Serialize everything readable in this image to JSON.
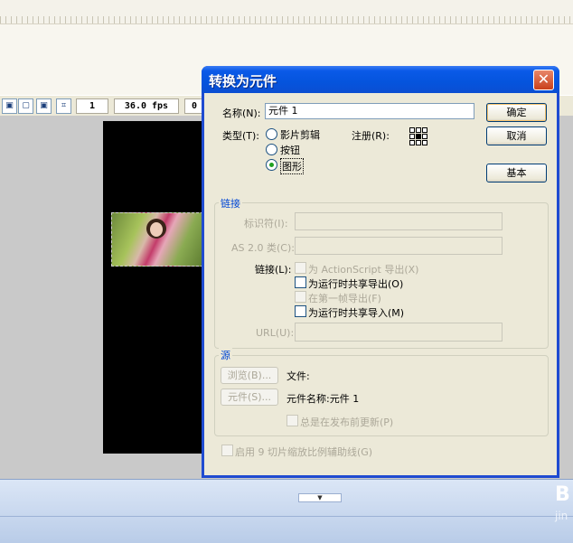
{
  "timeline": {
    "frame": "1",
    "fps": "36.0 fps",
    "time": "0"
  },
  "dialog": {
    "title": "转换为元件",
    "close": "✕",
    "name_label": "名称(N):",
    "name_value": "元件 1",
    "ok_label": "确定",
    "cancel_label": "取消",
    "basic_label": "基本",
    "type_label": "类型(T):",
    "types": [
      {
        "label": "影片剪辑",
        "selected": false
      },
      {
        "label": "按钮",
        "selected": false
      },
      {
        "label": "图形",
        "selected": true
      }
    ],
    "registration_label": "注册(R):"
  },
  "linkage": {
    "group_title": "链接",
    "identifier_label": "标识符(I):",
    "as_class_label": "AS 2.0 类(C):",
    "linkage_label": "链接(L):",
    "options": [
      {
        "label": "为 ActionScript 导出(X)",
        "enabled": false
      },
      {
        "label": "为运行时共享导出(O)",
        "enabled": true
      },
      {
        "label": "在第一帧导出(F)",
        "enabled": false
      },
      {
        "label": "为运行时共享导入(M)",
        "enabled": true
      }
    ],
    "url_label": "URL(U):"
  },
  "source": {
    "group_title": "源",
    "browse_label": "浏览(B)...",
    "file_label": "文件:",
    "symbol_button_label": "元件(S)...",
    "symbol_name_label": "元件名称:元件 1",
    "always_update_label": "总是在发布前更新(P)"
  },
  "nine_slice_label": "启用 9 切片缩放比例辅助线(G)",
  "watermark": {
    "main": "B",
    "sub": "jin"
  },
  "colors": {
    "titlebar": "#0554dd",
    "dialog_face": "#ece9d8",
    "group_title": "#0046d5",
    "stage": "#000000"
  }
}
